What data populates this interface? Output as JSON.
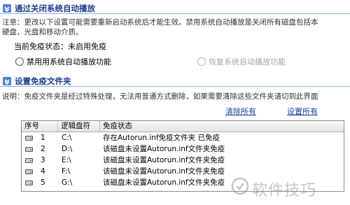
{
  "section1": {
    "title": "通过关闭系统自动播放",
    "note_line1": "注意：更改以下设置可能需要重新启动系统后才能生效。禁用系统自动播放是关闭所有磁盘包括本",
    "note_line2": "硬盘，光盘和移动介质。",
    "status_label": "当前免疫状态：",
    "status_value": "未启用免疫",
    "radio_disable": "禁用用系统自动播放功能",
    "radio_restore": "恢复系统自动播放功能",
    "radio_disable_selected": false,
    "radio_restore_enabled": false
  },
  "section2": {
    "title": "设置免疫文件夹",
    "note": "说明：免疫文件夹是经过特殊处理，无法用普通方式删除，如果需要清除这些文件夹请切到此界面",
    "clear_all": "清除所有",
    "set_all": "设置所有"
  },
  "table": {
    "headers": [
      "序号",
      "逻辑盘符",
      "免疫状态"
    ],
    "rows": [
      {
        "index": "1",
        "drive": "C:\\",
        "status": "存在Autorun.inf免疫文件夹  已免疫"
      },
      {
        "index": "2",
        "drive": "D:\\",
        "status": "该磁盘未设置Autorun.inf文件夹免疫"
      },
      {
        "index": "3",
        "drive": "E:\\",
        "status": "该磁盘未设置Autorun.inf文件夹免疫"
      },
      {
        "index": "4",
        "drive": "F:\\",
        "status": "该磁盘未设置Autorun.inf文件夹免疫"
      },
      {
        "index": "5",
        "drive": "G:\\",
        "status": "该磁盘未设置Autorun.inf文件夹免疫"
      }
    ]
  },
  "watermark": "软件技巧",
  "colors": {
    "header_text": "#1c3f8c",
    "link": "#1a3fa0",
    "separator": "#8fb3e6"
  }
}
